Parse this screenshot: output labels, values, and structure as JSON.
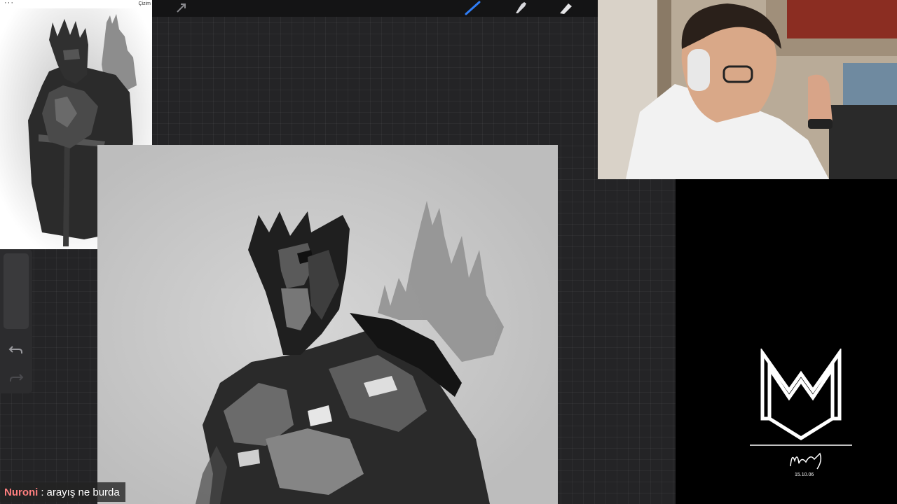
{
  "reference_panel": {
    "menu_label": "···",
    "title": "Çizim",
    "expand_icon": "expand-arrows-icon",
    "rotate_icon": "rotate-icon"
  },
  "toolbar": {
    "tools": [
      {
        "name": "adjustments-arrow",
        "icon": "arrow-icon",
        "active": false
      },
      {
        "name": "brush",
        "icon": "brush-icon",
        "active": true,
        "accent": "#2f7df6"
      },
      {
        "name": "smudge",
        "icon": "smudge-icon",
        "active": false
      },
      {
        "name": "eraser",
        "icon": "eraser-icon",
        "active": false
      }
    ]
  },
  "sidebar": {
    "undo_icon": "undo-icon",
    "redo_icon": "redo-icon"
  },
  "logo": {
    "letter": "M",
    "signature": "Murat",
    "date": "15.10.06"
  },
  "chat": {
    "username": "Nuroni",
    "separator": ":",
    "message": "arayış ne burda",
    "username_color": "#ff7f7f"
  }
}
